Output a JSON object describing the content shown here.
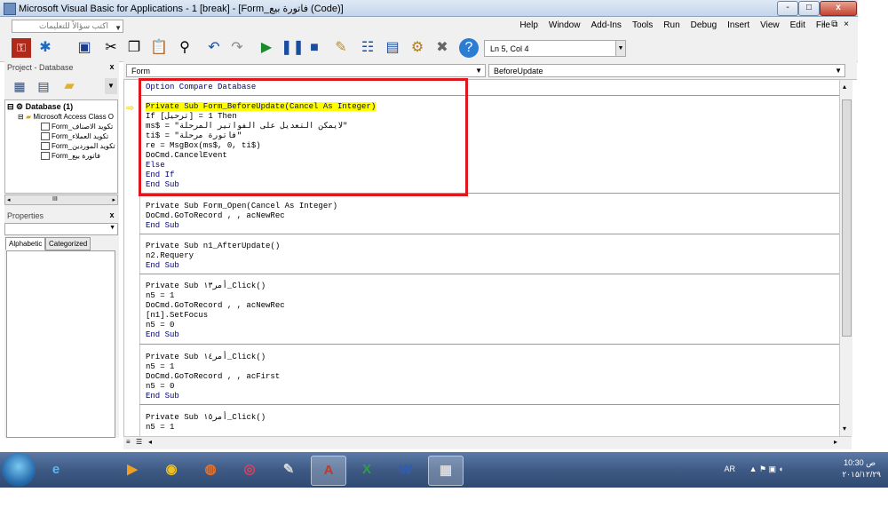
{
  "window": {
    "title": "Microsoft Visual Basic for Applications - 1 [break] - [Form_فاتورة بيع (Code)]",
    "min": "-",
    "max": "□",
    "close": "x"
  },
  "menubar": {
    "ask_placeholder": "اكتب سؤالاً للتعليمات",
    "items": [
      "Help",
      "Window",
      "Add-Ins",
      "Tools",
      "Run",
      "Debug",
      "Insert",
      "View",
      "Edit",
      "File"
    ],
    "right_controls": "- ⧉ ×"
  },
  "toolbar": {
    "position": "Ln 5, Col 4"
  },
  "project_panel": {
    "title": "Project - Database",
    "close": "x",
    "root": "Database (1)",
    "folder": "Microsoft Access Class O",
    "forms": [
      "Form_تكويد الاصناف",
      "Form_تكويد العملاء",
      "Form_تكويد الموردين",
      "Form_فاتورة بيع"
    ],
    "scroll_glyph": "III"
  },
  "properties_panel": {
    "title": "Properties",
    "close": "x",
    "tabs": [
      "Alphabetic",
      "Categorized"
    ]
  },
  "code_window": {
    "object_combo": "Form",
    "procedure_combo": "BeforeUpdate",
    "lines": [
      {
        "t": "Option Compare Database"
      },
      {
        "t": ""
      },
      {
        "t": "Private Sub Form_BeforeUpdate(Cancel As Integer)"
      },
      {
        "t": "If [ترحيل] = 1 Then"
      },
      {
        "t": "ms$ = \"لايمكن التعديل على الفواتير المرحلة\""
      },
      {
        "t": "ti$ = \"فاتورة مرحلة\""
      },
      {
        "t": "re = MsgBox(ms$, 0, ti$)"
      },
      {
        "t": "DoCmd.CancelEvent"
      },
      {
        "t": "Else"
      },
      {
        "t": "End If"
      },
      {
        "t": "End Sub"
      },
      {
        "t": "Private Sub Form_Open(Cancel As Integer)"
      },
      {
        "t": "DoCmd.GoToRecord , , acNewRec"
      },
      {
        "t": "End Sub"
      },
      {
        "t": "Private Sub n1_AfterUpdate()"
      },
      {
        "t": "n2.Requery"
      },
      {
        "t": "End Sub"
      },
      {
        "t": "Private Sub أمر١٣_Click()"
      },
      {
        "t": "n5 = 1"
      },
      {
        "t": "DoCmd.GoToRecord , , acNewRec"
      },
      {
        "t": "[n1].SetFocus"
      },
      {
        "t": "n5 = 0"
      },
      {
        "t": "End Sub"
      },
      {
        "t": "Private Sub أمر١٤_Click()"
      },
      {
        "t": "n5 = 1"
      },
      {
        "t": "DoCmd.GoToRecord , , acFirst"
      },
      {
        "t": "n5 = 0"
      },
      {
        "t": "End Sub"
      },
      {
        "t": "Private Sub أمر١٥_Click()"
      },
      {
        "t": "n5 = 1"
      }
    ]
  },
  "taskbar": {
    "lang": "AR",
    "time": "10:30 ص",
    "date": "٢٠١٥/١٢/٢٩"
  }
}
